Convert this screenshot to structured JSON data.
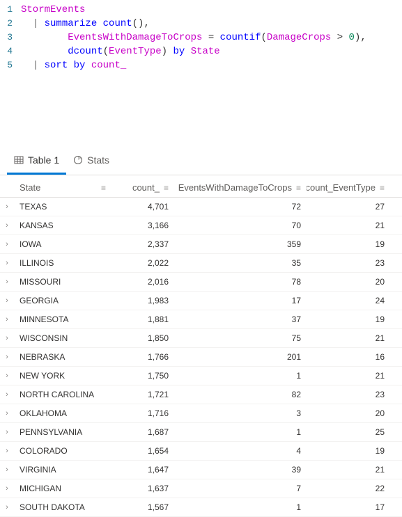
{
  "editor": {
    "lines": [
      {
        "num": "1",
        "tokens": [
          [
            "id",
            "StormEvents"
          ]
        ]
      },
      {
        "num": "2",
        "tokens": [
          [
            "",
            "  "
          ],
          [
            "pipe",
            "|"
          ],
          [
            "",
            ""
          ],
          [
            "kw",
            " summarize "
          ],
          [
            "fn",
            "count"
          ],
          [
            "op",
            "(),"
          ]
        ]
      },
      {
        "num": "3",
        "tokens": [
          [
            "",
            "        "
          ],
          [
            "id",
            "EventsWithDamageToCrops"
          ],
          [
            "op",
            " = "
          ],
          [
            "fn",
            "countif"
          ],
          [
            "op",
            "("
          ],
          [
            "id",
            "DamageCrops"
          ],
          [
            "op",
            " > "
          ],
          [
            "num",
            "0"
          ],
          [
            "op",
            "),"
          ]
        ]
      },
      {
        "num": "4",
        "tokens": [
          [
            "",
            "        "
          ],
          [
            "fn",
            "dcount"
          ],
          [
            "op",
            "("
          ],
          [
            "id",
            "EventType"
          ],
          [
            "op",
            ") "
          ],
          [
            "kw",
            "by"
          ],
          [
            "",
            ""
          ],
          [
            "id",
            " State"
          ]
        ]
      },
      {
        "num": "5",
        "tokens": [
          [
            "",
            "  "
          ],
          [
            "pipe",
            "|"
          ],
          [
            "",
            ""
          ],
          [
            "kw",
            " sort by "
          ],
          [
            "id",
            "count_"
          ]
        ]
      }
    ]
  },
  "tabs": {
    "table_label": "Table 1",
    "stats_label": "Stats"
  },
  "columns": {
    "state": "State",
    "count": "count_",
    "dmg": "EventsWithDamageToCrops",
    "dcount": "dcount_EventType"
  },
  "rows": [
    {
      "state": "TEXAS",
      "count": "4,701",
      "dmg": "72",
      "dcount": "27"
    },
    {
      "state": "KANSAS",
      "count": "3,166",
      "dmg": "70",
      "dcount": "21"
    },
    {
      "state": "IOWA",
      "count": "2,337",
      "dmg": "359",
      "dcount": "19"
    },
    {
      "state": "ILLINOIS",
      "count": "2,022",
      "dmg": "35",
      "dcount": "23"
    },
    {
      "state": "MISSOURI",
      "count": "2,016",
      "dmg": "78",
      "dcount": "20"
    },
    {
      "state": "GEORGIA",
      "count": "1,983",
      "dmg": "17",
      "dcount": "24"
    },
    {
      "state": "MINNESOTA",
      "count": "1,881",
      "dmg": "37",
      "dcount": "19"
    },
    {
      "state": "WISCONSIN",
      "count": "1,850",
      "dmg": "75",
      "dcount": "21"
    },
    {
      "state": "NEBRASKA",
      "count": "1,766",
      "dmg": "201",
      "dcount": "16"
    },
    {
      "state": "NEW YORK",
      "count": "1,750",
      "dmg": "1",
      "dcount": "21"
    },
    {
      "state": "NORTH CAROLINA",
      "count": "1,721",
      "dmg": "82",
      "dcount": "23"
    },
    {
      "state": "OKLAHOMA",
      "count": "1,716",
      "dmg": "3",
      "dcount": "20"
    },
    {
      "state": "PENNSYLVANIA",
      "count": "1,687",
      "dmg": "1",
      "dcount": "25"
    },
    {
      "state": "COLORADO",
      "count": "1,654",
      "dmg": "4",
      "dcount": "19"
    },
    {
      "state": "VIRGINIA",
      "count": "1,647",
      "dmg": "39",
      "dcount": "21"
    },
    {
      "state": "MICHIGAN",
      "count": "1,637",
      "dmg": "7",
      "dcount": "22"
    },
    {
      "state": "SOUTH DAKOTA",
      "count": "1,567",
      "dmg": "1",
      "dcount": "17"
    }
  ]
}
